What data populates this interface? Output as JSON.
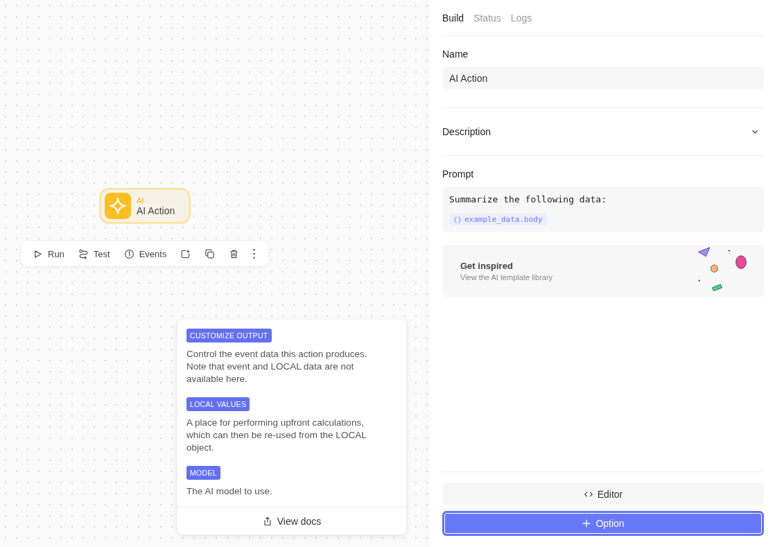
{
  "canvas": {
    "node": {
      "category": "AI",
      "title": "AI Action",
      "selected": true
    },
    "toolbar": [
      {
        "kind": "run",
        "label": "Run"
      },
      {
        "kind": "test",
        "label": "Test"
      },
      {
        "kind": "events",
        "label": "Events"
      },
      {
        "kind": "export"
      },
      {
        "kind": "duplicate"
      },
      {
        "kind": "delete"
      },
      {
        "kind": "more"
      }
    ],
    "help": {
      "sections": [
        {
          "tag": "CUSTOMIZE OUTPUT",
          "text": "Control the event data this action produces. Note that event and LOCAL data are not available here."
        },
        {
          "tag": "LOCAL VALUES",
          "text": "A place for performing upfront calculations, which can then be re-used from the LOCAL object."
        },
        {
          "tag": "MODEL",
          "text": "The AI model to use."
        }
      ],
      "link": "View docs"
    }
  },
  "panel": {
    "tabs": [
      {
        "label": "Build",
        "selected": true
      },
      {
        "label": "Status",
        "selected": false
      },
      {
        "label": "Logs",
        "selected": false
      }
    ],
    "name": {
      "label": "Name",
      "value": "AI Action"
    },
    "description": {
      "label": "Description",
      "expanded": false
    },
    "prompt": {
      "label": "Prompt",
      "text": "Summarize the following data:",
      "variable": "example_data.body"
    },
    "inspire": {
      "title": "Get inspired",
      "subtitle": "View the AI template library"
    },
    "editor_button": "Editor",
    "option_button": "Option"
  }
}
